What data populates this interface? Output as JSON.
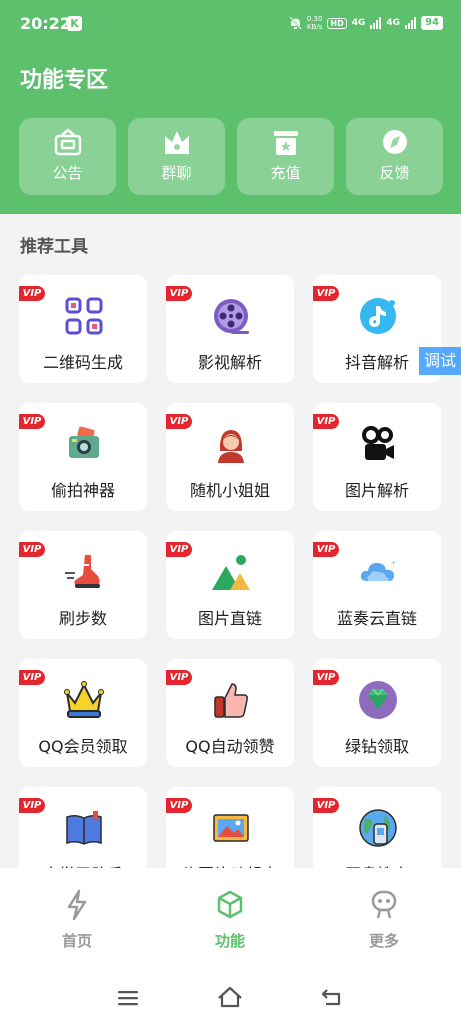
{
  "status_bar": {
    "time": "20:22",
    "app_badge": "K",
    "net_speed": "0.30",
    "net_unit": "KB/s",
    "hd": "HD",
    "sig1": "4G",
    "sig2": "4G",
    "battery": "94"
  },
  "header": {
    "title": "功能专区"
  },
  "quick_actions": [
    {
      "label": "公告",
      "icon": "announcement-icon"
    },
    {
      "label": "群聊",
      "icon": "group-crown-icon"
    },
    {
      "label": "充值",
      "icon": "gift-box-icon"
    },
    {
      "label": "反馈",
      "icon": "compass-icon"
    }
  ],
  "section": {
    "title": "推荐工具"
  },
  "vip_badge": "VIP",
  "tools": [
    {
      "label": "二维码生成",
      "icon": "qrcode-icon"
    },
    {
      "label": "影视解析",
      "icon": "film-reel-icon"
    },
    {
      "label": "抖音解析",
      "icon": "tiktok-icon"
    },
    {
      "label": "偷拍神器",
      "icon": "camera-icon"
    },
    {
      "label": "随机小姐姐",
      "icon": "girl-avatar-icon"
    },
    {
      "label": "图片解析",
      "icon": "kuaishou-camera-icon"
    },
    {
      "label": "刷步数",
      "icon": "running-shoe-icon"
    },
    {
      "label": "图片直链",
      "icon": "mountain-image-icon"
    },
    {
      "label": "蓝奏云直链",
      "icon": "cloud-icon"
    },
    {
      "label": "QQ会员领取",
      "icon": "crown-icon"
    },
    {
      "label": "QQ自动领赞",
      "icon": "thumbs-up-icon"
    },
    {
      "label": "绿钻领取",
      "icon": "diamond-icon"
    },
    {
      "label": "大学习助手",
      "icon": "book-icon"
    },
    {
      "label": "头图片动起来",
      "icon": "picture-icon"
    },
    {
      "label": "网盘搜索",
      "icon": "globe-phone-icon"
    }
  ],
  "debug_button": {
    "label": "调试"
  },
  "bottom_nav": [
    {
      "label": "首页",
      "icon": "lightning-icon",
      "active": false
    },
    {
      "label": "功能",
      "icon": "cube-icon",
      "active": true
    },
    {
      "label": "更多",
      "icon": "robot-icon",
      "active": false
    }
  ],
  "colors": {
    "primary": "#5cc06c",
    "vip": "#e3262d",
    "inactive": "#9a9a9a"
  }
}
